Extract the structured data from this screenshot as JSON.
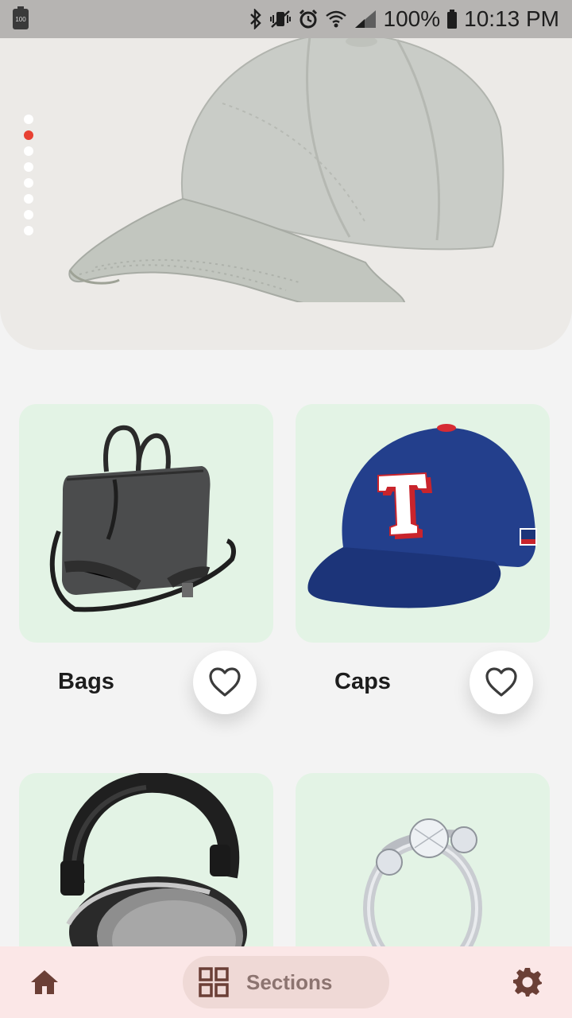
{
  "status_bar": {
    "battery_badge": "100",
    "battery_percent": "100%",
    "time": "10:13 PM",
    "icons": [
      "bluetooth-icon",
      "vibrate-icon",
      "alarm-icon",
      "wifi-icon",
      "signal-icon",
      "battery-icon"
    ]
  },
  "hero": {
    "image": "grey-baseball-cap",
    "slide_count": 8,
    "active_slide": 2
  },
  "cards": [
    {
      "label": "Bags",
      "image": "grey-laptop-bag",
      "favorite_icon": "heart-outline-icon"
    },
    {
      "label": "Caps",
      "image": "blue-texas-rangers-cap",
      "favorite_icon": "heart-outline-icon"
    },
    {
      "label": "",
      "image": "black-headphones"
    },
    {
      "label": "",
      "image": "silver-three-stone-ring"
    }
  ],
  "bottom_nav": {
    "home_icon": "home-icon",
    "sections_label": "Sections",
    "sections_icon": "grid-icon",
    "settings_icon": "gear-icon"
  },
  "colors": {
    "accent_dot": "#e84132",
    "card_bg": "#e3f3e5",
    "nav_bg": "#fbe7e7",
    "nav_icon": "#6b3f36"
  }
}
